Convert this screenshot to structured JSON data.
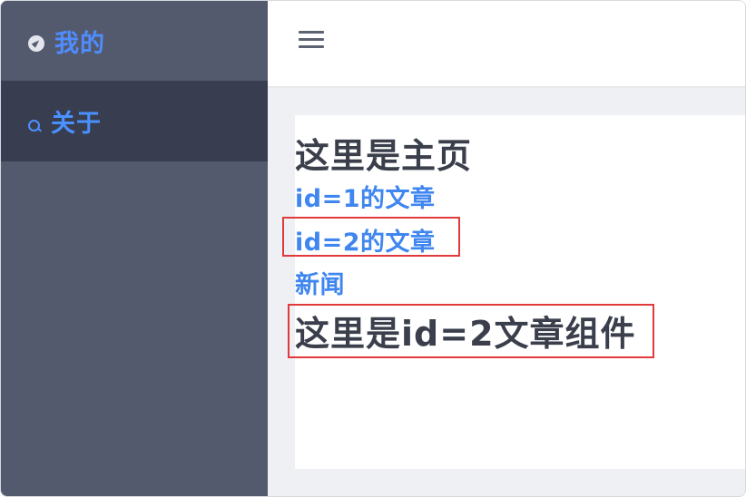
{
  "sidebar": {
    "items": [
      {
        "label": "我的",
        "icon": "compass-icon"
      },
      {
        "label": "关于",
        "icon": "search-icon"
      }
    ]
  },
  "header": {
    "menu_icon": "hamburger-icon"
  },
  "main": {
    "title": "这里是主页",
    "links": [
      {
        "label": "id=1的文章"
      },
      {
        "label": "id=2的文章"
      },
      {
        "label": "新闻"
      }
    ],
    "component_text": "这里是id=2文章组件"
  },
  "colors": {
    "sidebar_bg": "#535a6e",
    "sidebar_active_bg": "#383e4f",
    "accent_blue": "#4f8dff",
    "highlight_red": "#e03a3a",
    "text_dark": "#3a3f4b"
  }
}
